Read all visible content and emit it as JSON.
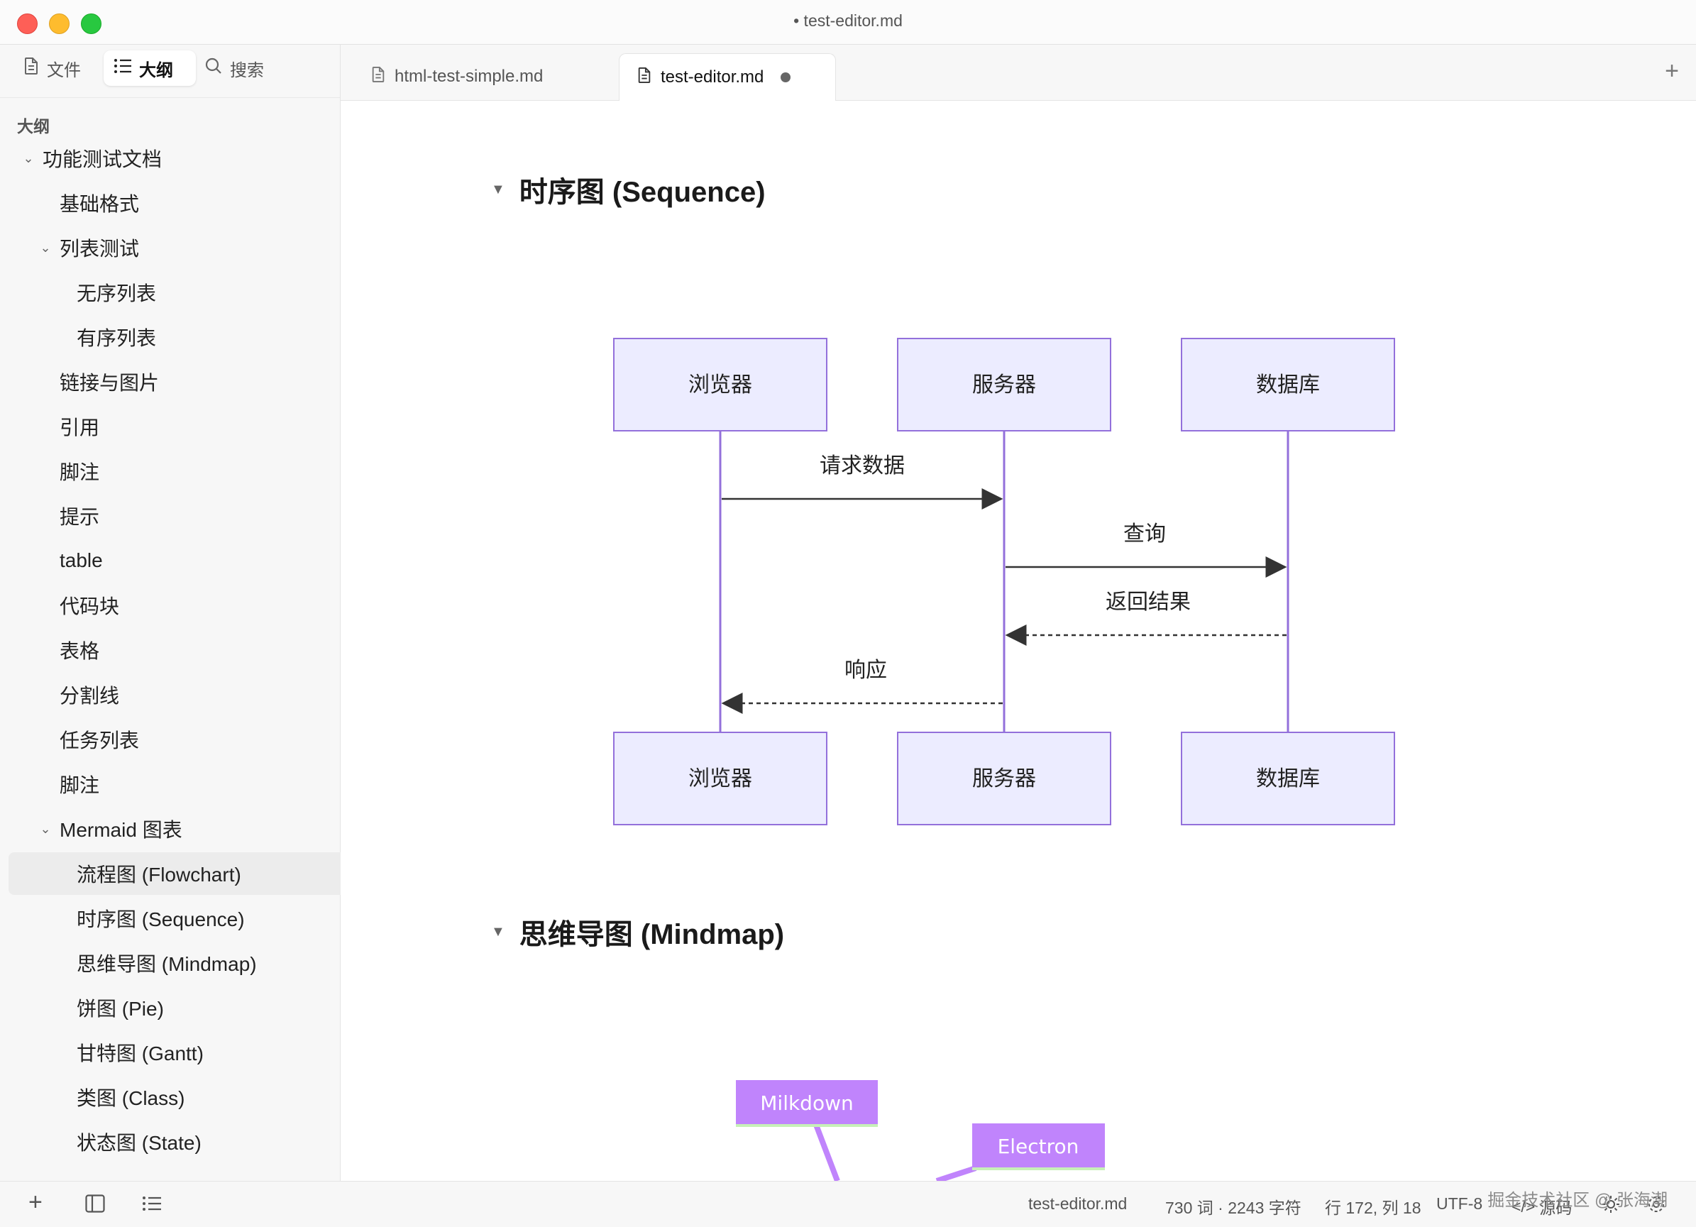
{
  "window": {
    "title": "• test-editor.md"
  },
  "sidebar": {
    "tabs": [
      {
        "label": "文件",
        "icon": "file-icon"
      },
      {
        "label": "大纲",
        "icon": "list-icon"
      },
      {
        "label": "搜索",
        "icon": "search-icon"
      }
    ],
    "outline_heading": "大纲",
    "items": [
      {
        "label": "功能测试文档",
        "level": 0,
        "expanded": true
      },
      {
        "label": "基础格式",
        "level": 1
      },
      {
        "label": "列表测试",
        "level": 1,
        "expanded": true
      },
      {
        "label": "无序列表",
        "level": 2
      },
      {
        "label": "有序列表",
        "level": 2
      },
      {
        "label": "链接与图片",
        "level": 1
      },
      {
        "label": "引用",
        "level": 1
      },
      {
        "label": "脚注",
        "level": 1
      },
      {
        "label": "提示",
        "level": 1
      },
      {
        "label": "table",
        "level": 1
      },
      {
        "label": "代码块",
        "level": 1
      },
      {
        "label": "表格",
        "level": 1
      },
      {
        "label": "分割线",
        "level": 1
      },
      {
        "label": "任务列表",
        "level": 1
      },
      {
        "label": "脚注",
        "level": 1
      },
      {
        "label": "Mermaid 图表",
        "level": 1,
        "expanded": true
      },
      {
        "label": "流程图 (Flowchart)",
        "level": 2,
        "active": true
      },
      {
        "label": "时序图 (Sequence)",
        "level": 2
      },
      {
        "label": "思维导图 (Mindmap)",
        "level": 2
      },
      {
        "label": "饼图 (Pie)",
        "level": 2
      },
      {
        "label": "甘特图 (Gantt)",
        "level": 2
      },
      {
        "label": "类图 (Class)",
        "level": 2
      },
      {
        "label": "状态图 (State)",
        "level": 2
      }
    ]
  },
  "tabs": [
    {
      "label": "html-test-simple.md",
      "active": false
    },
    {
      "label": "test-editor.md",
      "active": true,
      "dirty": true
    }
  ],
  "editor": {
    "headings": [
      {
        "text": "时序图 (Sequence)"
      },
      {
        "text": "思维导图 (Mindmap)"
      }
    ],
    "sequence": {
      "participants": [
        "浏览器",
        "服务器",
        "数据库"
      ],
      "messages": [
        {
          "from": 0,
          "to": 1,
          "label": "请求数据",
          "style": "solid"
        },
        {
          "from": 1,
          "to": 2,
          "label": "查询",
          "style": "solid"
        },
        {
          "from": 2,
          "to": 1,
          "label": "返回结果",
          "style": "dashed"
        },
        {
          "from": 1,
          "to": 0,
          "label": "响应",
          "style": "dashed"
        }
      ]
    },
    "mindmap": {
      "nodes": [
        "Milkdown",
        "Electron"
      ]
    }
  },
  "statusbar": {
    "filename": "test-editor.md",
    "counts": "730 词 · 2243 字符",
    "position": "行 172, 列 18",
    "encoding": "UTF-8",
    "source_label": "源码",
    "watermark": "掘金技术社区 @ 张海潮"
  },
  "colors": {
    "actor_fill": "#ececff",
    "actor_stroke": "#9370db",
    "mindmap_node": "#c084fc",
    "accent": "#1a1a1a"
  }
}
